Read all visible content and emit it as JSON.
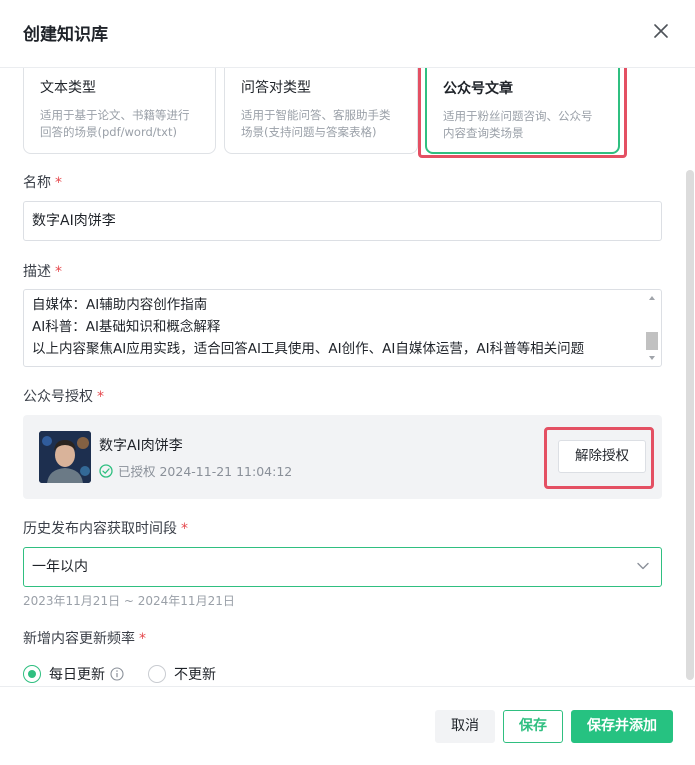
{
  "dialog": {
    "title": "创建知识库"
  },
  "types": [
    {
      "title": "文本类型",
      "desc": "适用于基于论文、书籍等进行回答的场景(pdf/word/txt)"
    },
    {
      "title": "问答对类型",
      "desc": "适用于智能问答、客服助手类场景(支持问题与答案表格)"
    },
    {
      "title": "公众号文章",
      "desc": "适用于粉丝问题咨询、公众号内容查询类场景",
      "selected": true
    }
  ],
  "name_field": {
    "label": "名称",
    "required": "*",
    "value": "数字AI肉饼李"
  },
  "desc_field": {
    "label": "描述",
    "required": "*",
    "lines": [
      "自媒体：AI辅助内容创作指南",
      "AI科普：AI基础知识和概念解释",
      "以上内容聚焦AI应用实践，适合回答AI工具使用、AI创作、AI自媒体运营，AI科普等相关问题"
    ]
  },
  "auth": {
    "label": "公众号授权",
    "required": "*",
    "account_name": "数字AI肉饼李",
    "status": "已授权 2024-11-21 11:04:12",
    "revoke_label": "解除授权"
  },
  "history": {
    "label": "历史发布内容获取时间段",
    "required": "*",
    "selected": "一年以内",
    "range_hint": "2023年11月21日 ~ 2024年11月21日"
  },
  "frequency": {
    "label": "新增内容更新频率",
    "required": "*",
    "options": [
      {
        "label": "每日更新",
        "checked": true
      },
      {
        "label": "不更新",
        "checked": false
      }
    ]
  },
  "footer": {
    "cancel": "取消",
    "save": "保存",
    "save_add": "保存并添加"
  },
  "colors": {
    "accent": "#26c281",
    "highlight": "#e45063",
    "required": "#e5484d"
  }
}
